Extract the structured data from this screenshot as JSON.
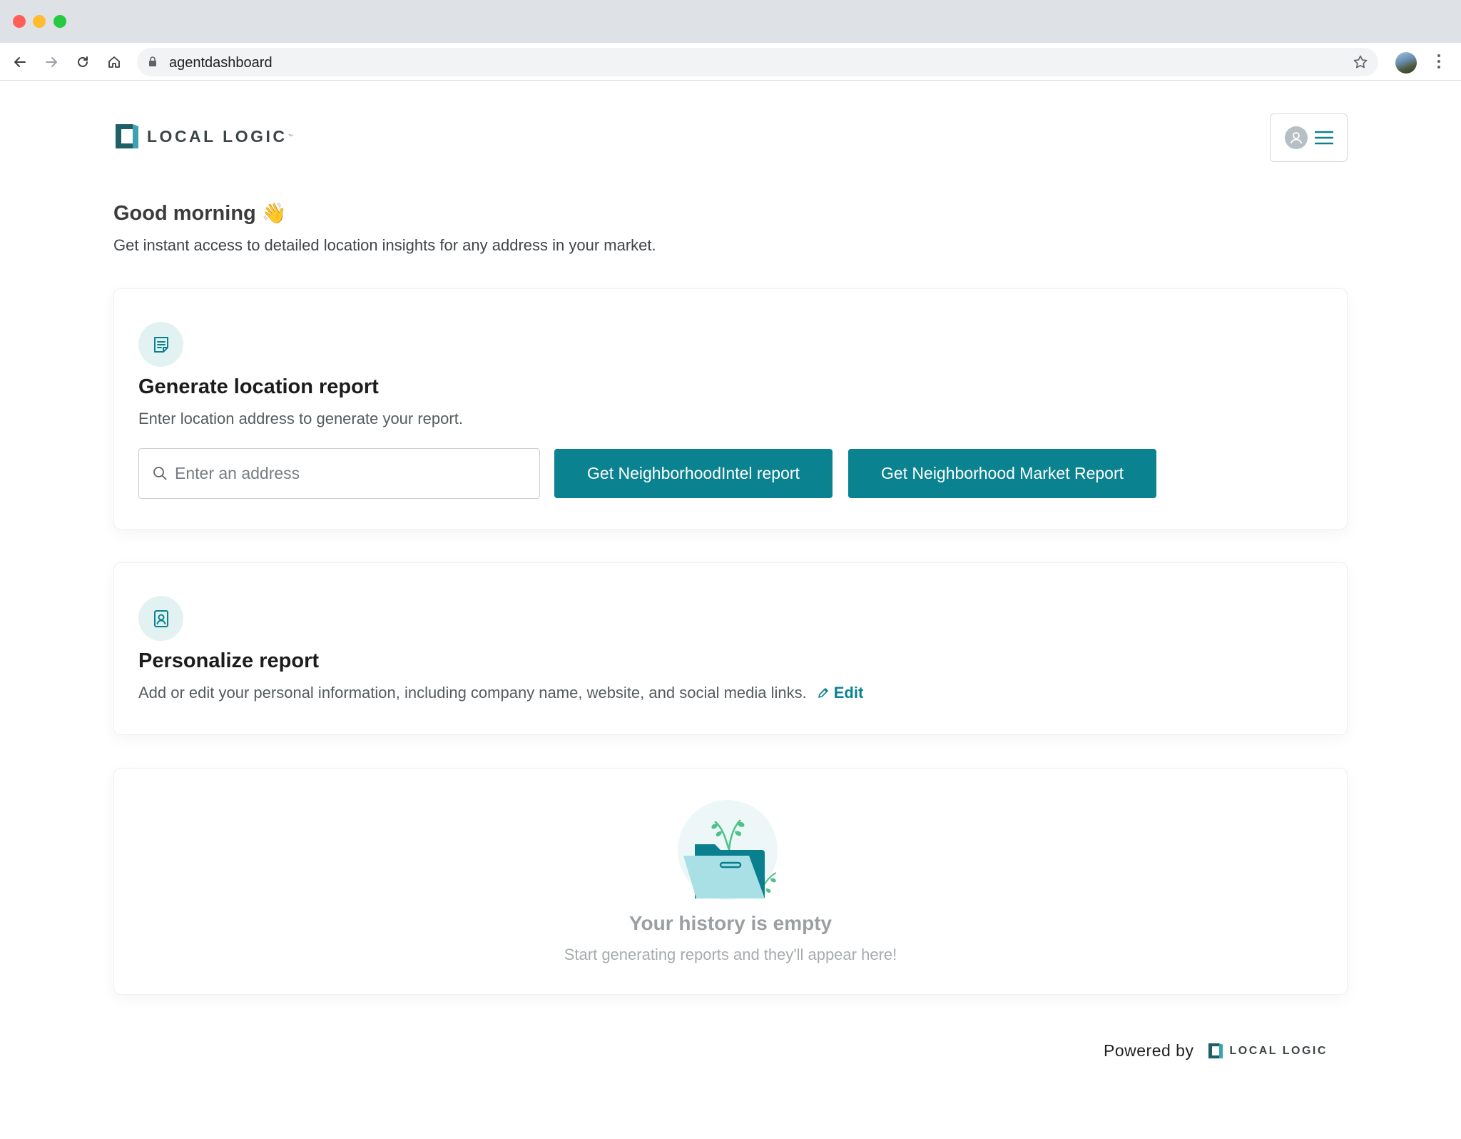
{
  "browser": {
    "url": "agentdashboard"
  },
  "header": {
    "logo_text": "LOCAL LOGIC"
  },
  "greeting": {
    "title": "Good morning",
    "emoji": "👋",
    "subtitle": "Get instant access to detailed location insights for any address in your market."
  },
  "generate_card": {
    "title": "Generate location report",
    "description": "Enter location address to generate your report.",
    "address_placeholder": "Enter an address",
    "address_value": "",
    "button_intel": "Get NeighborhoodIntel report",
    "button_market": "Get Neighborhood Market Report"
  },
  "personalize_card": {
    "title": "Personalize report",
    "description": "Add or edit your personal information, including company name, website, and social media links.",
    "edit_label": "Edit"
  },
  "history_card": {
    "title": "Your history is empty",
    "subtitle": "Start generating reports and they'll appear here!"
  },
  "footer": {
    "powered_label": "Powered by",
    "logo_text": "LOCAL LOGIC"
  },
  "colors": {
    "accent": "#0a8290",
    "icon_bg": "#e2f2f3",
    "logo_dark": "#1f5f66",
    "logo_light": "#3aa2b0"
  },
  "icons": {
    "back": "arrow-left-icon",
    "forward": "arrow-right-icon",
    "reload": "reload-icon",
    "home": "home-icon",
    "lock": "lock-icon",
    "bookmark": "star-icon",
    "menu": "hamburger-icon",
    "user": "user-icon",
    "report": "document-icon",
    "personalize": "id-badge-icon",
    "search": "search-icon",
    "edit": "pencil-icon",
    "empty": "folder-plant-illustration"
  }
}
